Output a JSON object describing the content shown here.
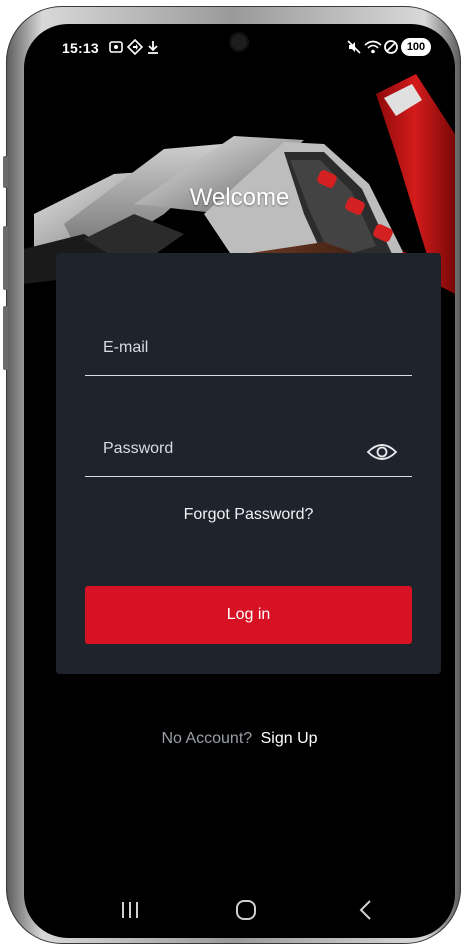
{
  "status_bar": {
    "time": "15:13",
    "battery": "100"
  },
  "hero": {
    "title": "Welcome"
  },
  "login_form": {
    "email_placeholder": "E-mail",
    "password_placeholder": "Password",
    "forgot_password": "Forgot Password?",
    "login_label": "Log in"
  },
  "footer": {
    "no_account": "No Account?",
    "sign_up": "Sign Up"
  },
  "colors": {
    "accent": "#d81225",
    "card": "#1f232b",
    "background": "#000000"
  },
  "icons": {
    "password_toggle": "eye-icon",
    "nav_recents": "recents-icon",
    "nav_home": "home-icon",
    "nav_back": "back-icon"
  }
}
